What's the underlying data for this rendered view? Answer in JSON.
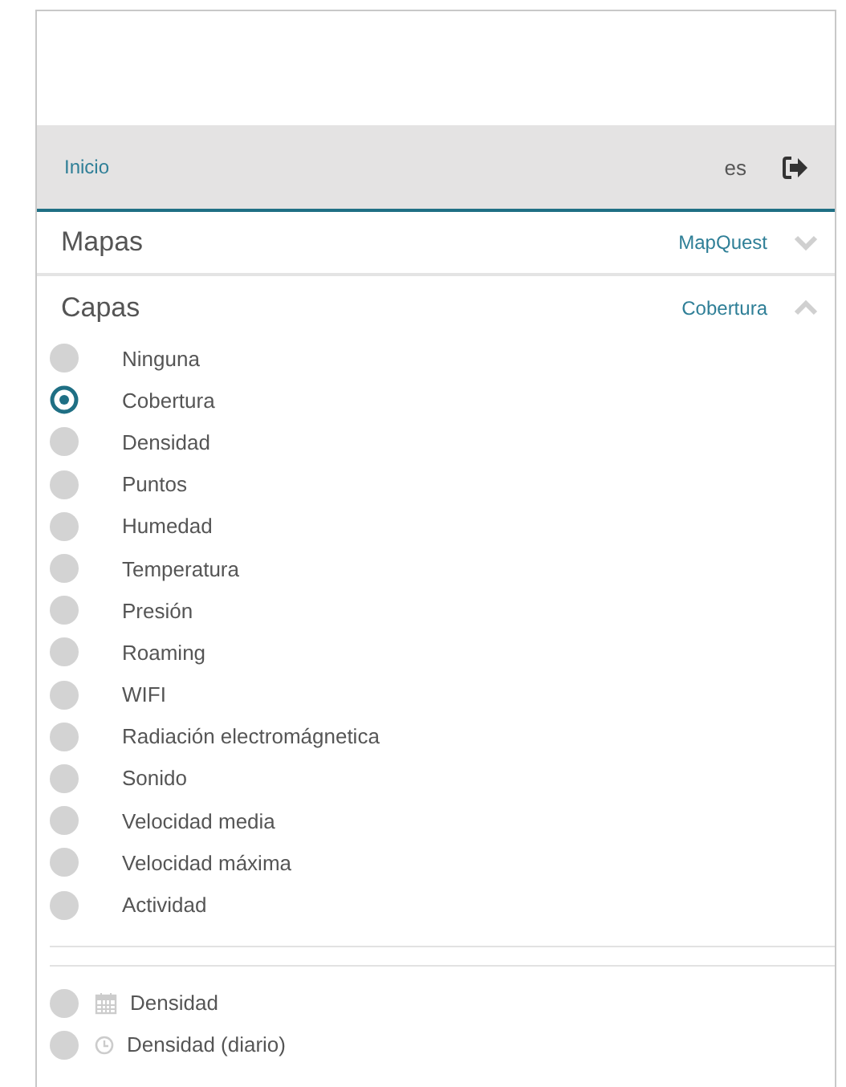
{
  "nav": {
    "home_link": "Inicio",
    "language": "es"
  },
  "maps": {
    "title": "Mapas",
    "current": "MapQuest",
    "expanded": false
  },
  "layers": {
    "title": "Capas",
    "current": "Cobertura",
    "expanded": true,
    "items": [
      {
        "label": "Ninguna",
        "selected": false
      },
      {
        "label": "Cobertura",
        "selected": true
      },
      {
        "label": "Densidad",
        "selected": false
      },
      {
        "label": "Puntos",
        "selected": false
      },
      {
        "label": "Humedad",
        "selected": false
      },
      {
        "label": "Temperatura",
        "selected": false
      },
      {
        "label": "Presión",
        "selected": false
      },
      {
        "label": "Roaming",
        "selected": false
      },
      {
        "label": "WIFI",
        "selected": false
      },
      {
        "label": "Radiación electromágnetica",
        "selected": false
      },
      {
        "label": "Sonido",
        "selected": false
      },
      {
        "label": "Velocidad media",
        "selected": false
      },
      {
        "label": "Velocidad máxima",
        "selected": false
      },
      {
        "label": "Actividad",
        "selected": false
      }
    ]
  },
  "extra_layers": [
    {
      "label": "Densidad",
      "selected": false,
      "kind": "calendar"
    },
    {
      "label": "Densidad (diario)",
      "selected": false,
      "kind": "clock"
    }
  ]
}
